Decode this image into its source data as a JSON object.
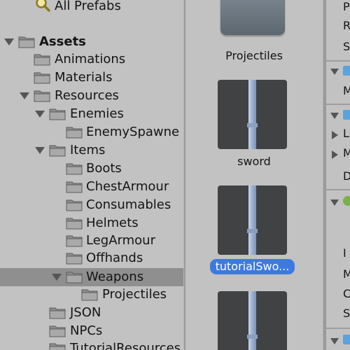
{
  "tree": {
    "items": [
      {
        "label": "All Prefabs",
        "icon": "search-icon"
      },
      {
        "label": "Assets",
        "icon": "folder-icon"
      },
      {
        "label": "Animations",
        "icon": "folder-icon"
      },
      {
        "label": "Materials",
        "icon": "folder-icon"
      },
      {
        "label": "Resources",
        "icon": "folder-icon"
      },
      {
        "label": "Enemies",
        "icon": "folder-icon"
      },
      {
        "label": "EnemySpawne",
        "icon": "folder-icon"
      },
      {
        "label": "Items",
        "icon": "folder-icon"
      },
      {
        "label": "Boots",
        "icon": "folder-icon"
      },
      {
        "label": "ChestArmour",
        "icon": "folder-icon"
      },
      {
        "label": "Consumables",
        "icon": "folder-icon"
      },
      {
        "label": "Helmets",
        "icon": "folder-icon"
      },
      {
        "label": "LegArmour",
        "icon": "folder-icon"
      },
      {
        "label": "Offhands",
        "icon": "folder-icon"
      },
      {
        "label": "Weapons",
        "icon": "folder-icon"
      },
      {
        "label": "Projectiles",
        "icon": "folder-icon"
      },
      {
        "label": "JSON",
        "icon": "folder-icon"
      },
      {
        "label": "NPCs",
        "icon": "folder-icon"
      },
      {
        "label": "TutorialResources",
        "icon": "folder-icon"
      }
    ],
    "selected": "Weapons"
  },
  "grid": {
    "items": [
      {
        "label": "Projectiles",
        "icon": "folder-icon"
      },
      {
        "label": "sword",
        "icon": "sword-prefab-icon"
      },
      {
        "label": "tutorialSwo...",
        "icon": "sword-prefab-icon"
      },
      {
        "label": "",
        "icon": "sword-prefab-icon"
      }
    ]
  },
  "inspector": {
    "letters": [
      "P",
      "R",
      "S",
      "M",
      "L",
      "M",
      "D",
      "I",
      "M",
      "C",
      "S"
    ]
  },
  "colors": {
    "panel_bg": "#c2c2c2",
    "selection_row": "#8f8f8f",
    "selection_label": "#3d7ae0",
    "thumb_bg": "#414244"
  }
}
